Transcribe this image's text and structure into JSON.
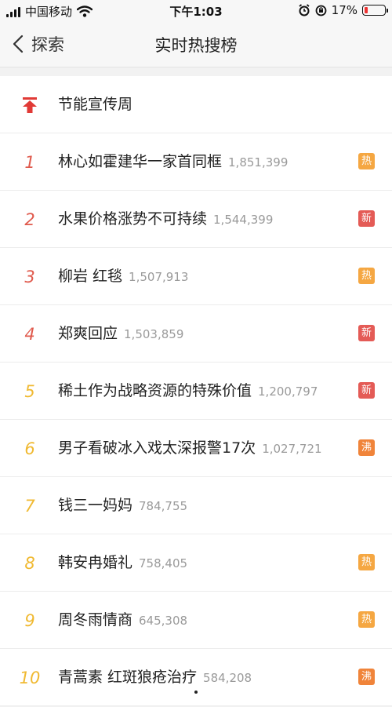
{
  "status": {
    "carrier": "中国移动",
    "time": "下午1:03",
    "battery": "17%"
  },
  "nav": {
    "back_label": "探索",
    "title": "实时热搜榜"
  },
  "pinned": {
    "title": "节能宣传周"
  },
  "colors": {
    "rank_top": "#e05a4d",
    "rank_other": "#f0b931",
    "badge_hot": "#f5a742",
    "badge_new": "#e45b56",
    "badge_boil": "#f0843a",
    "pin": "#e13a36"
  },
  "items": [
    {
      "rank": "1",
      "title": "林心如霍建华一家首同框",
      "count": "1,851,399",
      "badge": "热"
    },
    {
      "rank": "2",
      "title": "水果价格涨势不可持续",
      "count": "1,544,399",
      "badge": "新"
    },
    {
      "rank": "3",
      "title": "柳岩 红毯",
      "count": "1,507,913",
      "badge": "热"
    },
    {
      "rank": "4",
      "title": "郑爽回应",
      "count": "1,503,859",
      "badge": "新"
    },
    {
      "rank": "5",
      "title": "稀土作为战略资源的特殊价值",
      "count": "1,200,797",
      "badge": "新"
    },
    {
      "rank": "6",
      "title": "男子看破冰入戏太深报警17次",
      "count": "1,027,721",
      "badge": "沸"
    },
    {
      "rank": "7",
      "title": "钱三一妈妈",
      "count": "784,755",
      "badge": ""
    },
    {
      "rank": "8",
      "title": "韩安冉婚礼",
      "count": "758,405",
      "badge": "热"
    },
    {
      "rank": "9",
      "title": "周冬雨情商",
      "count": "645,308",
      "badge": "热"
    },
    {
      "rank": "10",
      "title": "青蒿素 红斑狼疮治疗",
      "count": "584,208",
      "badge": "沸"
    }
  ]
}
